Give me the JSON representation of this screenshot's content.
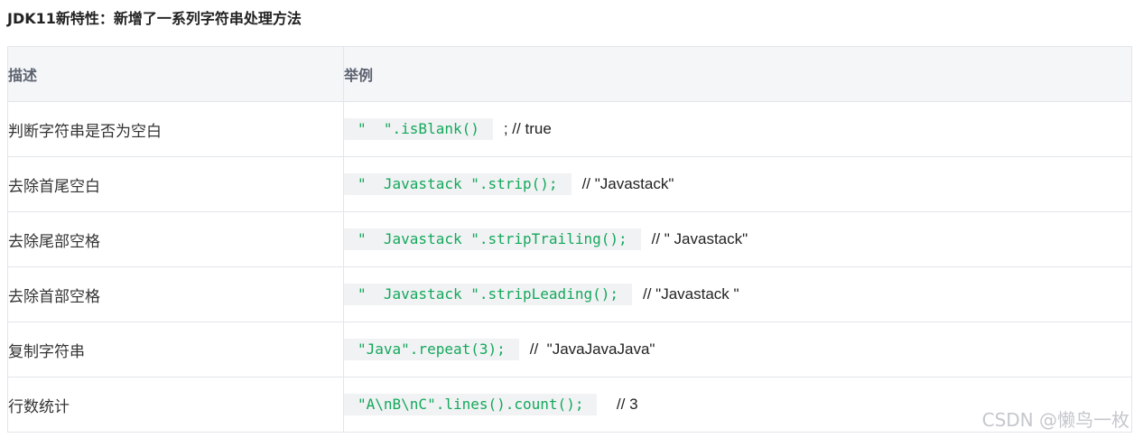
{
  "page": {
    "title": "JDK11新特性：新增了一系列字符串处理方法"
  },
  "table": {
    "headers": {
      "description": "描述",
      "example": "举例"
    },
    "rows": [
      {
        "description": "判断字符串是否为空白",
        "code": "\"  \".isBlank()",
        "comment": "; // true"
      },
      {
        "description": "去除首尾空白",
        "code": "\"  Javastack \".strip();",
        "comment": "// \"Javastack\""
      },
      {
        "description": "去除尾部空格",
        "code": "\"  Javastack \".stripTrailing();",
        "comment": "// \" Javastack\""
      },
      {
        "description": "去除首部空格",
        "code": "\"  Javastack \".stripLeading();",
        "comment": "// \"Javastack \""
      },
      {
        "description": "复制字符串",
        "code": "\"Java\".repeat(3);",
        "comment": "//  \"JavaJavaJava\""
      },
      {
        "description": "行数统计",
        "code": "\"A\\nB\\nC\".lines().count();",
        "comment": "  // 3"
      }
    ]
  },
  "watermark": {
    "text": "CSDN @懒鸟一枚"
  },
  "colors": {
    "code_text": "#14a85b",
    "code_background": "#f1f2f4",
    "header_background": "#f5f6f8",
    "border": "#e2e5ea"
  }
}
